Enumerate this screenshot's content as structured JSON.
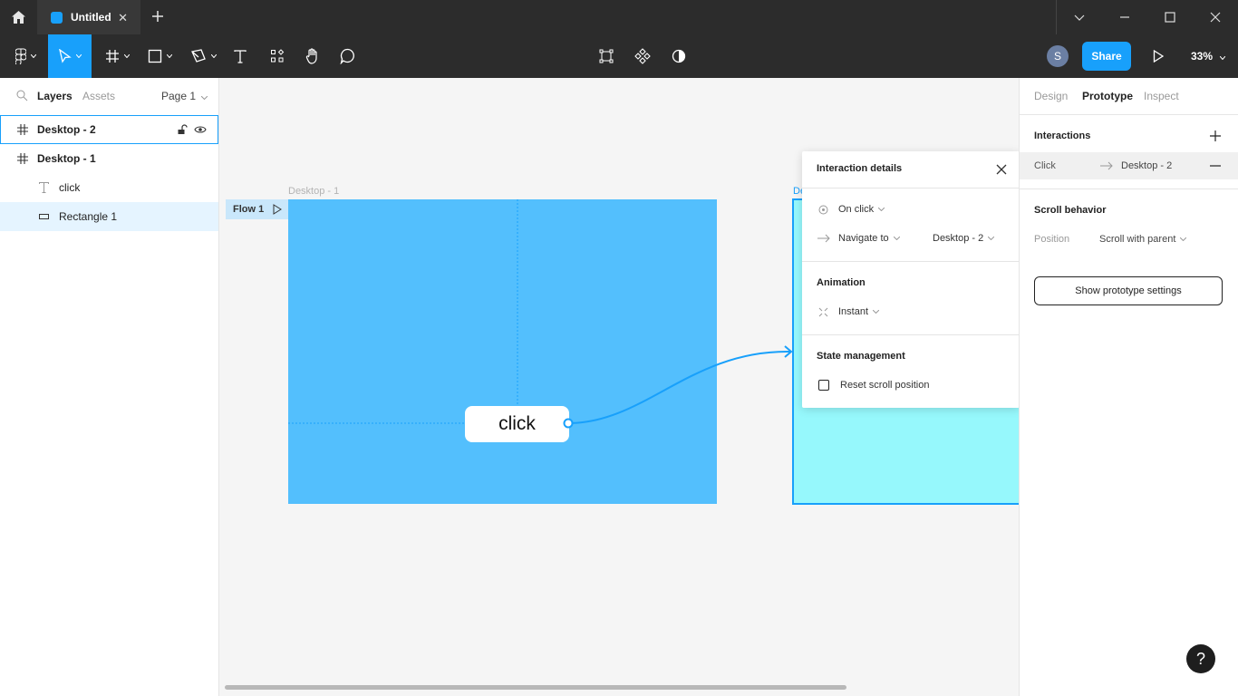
{
  "titlebar": {
    "tab_title": "Untitled",
    "tab_close": "✕",
    "new_tab": "+"
  },
  "toolbar": {
    "avatar_initial": "S",
    "share_label": "Share",
    "zoom_label": "33%"
  },
  "left_panel": {
    "tabs": {
      "layers": "Layers",
      "assets": "Assets",
      "page": "Page 1"
    },
    "layers": [
      {
        "name": "Desktop - 2",
        "icon": "frame-icon"
      },
      {
        "name": "Desktop - 1",
        "icon": "frame-icon"
      },
      {
        "name": "click",
        "icon": "text-icon"
      },
      {
        "name": "Rectangle 1",
        "icon": "rectangle-icon"
      }
    ]
  },
  "canvas": {
    "frame1_label": "Desktop - 1",
    "frame2_label": "De",
    "flow_label": "Flow 1",
    "button_text": "click"
  },
  "interaction_popup": {
    "title": "Interaction details",
    "trigger": "On click",
    "action": "Navigate to",
    "destination": "Desktop - 2",
    "animation_heading": "Animation",
    "animation_value": "Instant",
    "state_heading": "State management",
    "reset_scroll_label": "Reset scroll position"
  },
  "right_panel": {
    "tabs": {
      "design": "Design",
      "prototype": "Prototype",
      "inspect": "Inspect"
    },
    "interactions_heading": "Interactions",
    "interaction_trigger": "Click",
    "interaction_target": "Desktop - 2",
    "scroll_heading": "Scroll behavior",
    "position_label": "Position",
    "position_value": "Scroll with parent",
    "prototype_settings_button": "Show prototype settings"
  },
  "help_label": "?",
  "colors": {
    "accent": "#18a0fb",
    "frame1_fill": "#53bffd",
    "frame2_fill": "#96f8fc",
    "toolbar_bg": "#2c2c2c"
  }
}
